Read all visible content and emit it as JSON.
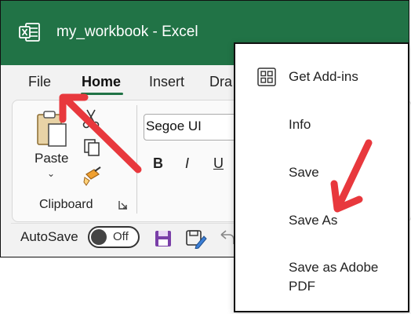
{
  "titlebar": {
    "app_title": "my_workbook  -  Excel",
    "brand_color": "#217346",
    "logo_icon": "excel-logo-icon"
  },
  "tabs": [
    {
      "label": "File"
    },
    {
      "label": "Home",
      "active": true
    },
    {
      "label": "Insert"
    },
    {
      "label": "Dra"
    }
  ],
  "ribbon": {
    "clipboard": {
      "paste_label": "Paste",
      "group_label": "Clipboard",
      "icons": [
        "clipboard-icon",
        "scissors-icon",
        "copy-icon",
        "format-painter-icon",
        "dialog-launcher-icon"
      ]
    },
    "font": {
      "font_name": "Segoe UI",
      "bold": "B",
      "italic": "I",
      "underline": "U"
    }
  },
  "quick_access": {
    "autosave_label": "AutoSave",
    "toggle_state": "Off",
    "icons": [
      "save-icon",
      "save-edit-icon",
      "undo-icon"
    ]
  },
  "file_menu": {
    "items": [
      {
        "label": "Get Add-ins",
        "icon": "add-ins-grid-icon"
      },
      {
        "label": "Info"
      },
      {
        "label": "Save"
      },
      {
        "label": "Save As"
      },
      {
        "label": "Save as Adobe PDF"
      }
    ]
  },
  "annotation": {
    "arrow_color": "#e8383d"
  }
}
